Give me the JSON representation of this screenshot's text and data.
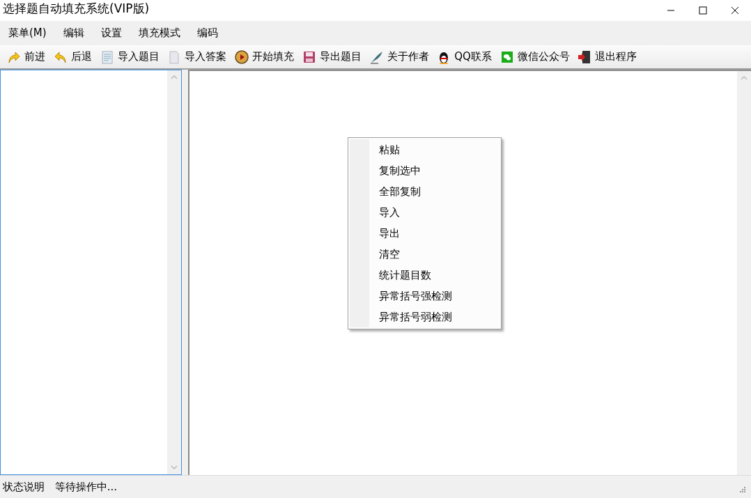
{
  "window": {
    "title": "选择题自动填充系统(VIP版)"
  },
  "menu_bar": [
    "菜单(M)",
    "编辑",
    "设置",
    "填充模式",
    "编码"
  ],
  "toolbar": [
    {
      "label": "前进"
    },
    {
      "label": "后退"
    },
    {
      "label": "导入题目"
    },
    {
      "label": "导入答案"
    },
    {
      "label": "开始填充"
    },
    {
      "label": "导出题目"
    },
    {
      "label": "关于作者"
    },
    {
      "label": "QQ联系"
    },
    {
      "label": "微信公众号"
    },
    {
      "label": "退出程序"
    }
  ],
  "context_menu": [
    "粘贴",
    "复制选中",
    "全部复制",
    "导入",
    "导出",
    "清空",
    "统计题目数",
    "异常括号强检测",
    "异常括号弱检测"
  ],
  "status_bar": {
    "label": "状态说明",
    "message": "等待操作中..."
  }
}
